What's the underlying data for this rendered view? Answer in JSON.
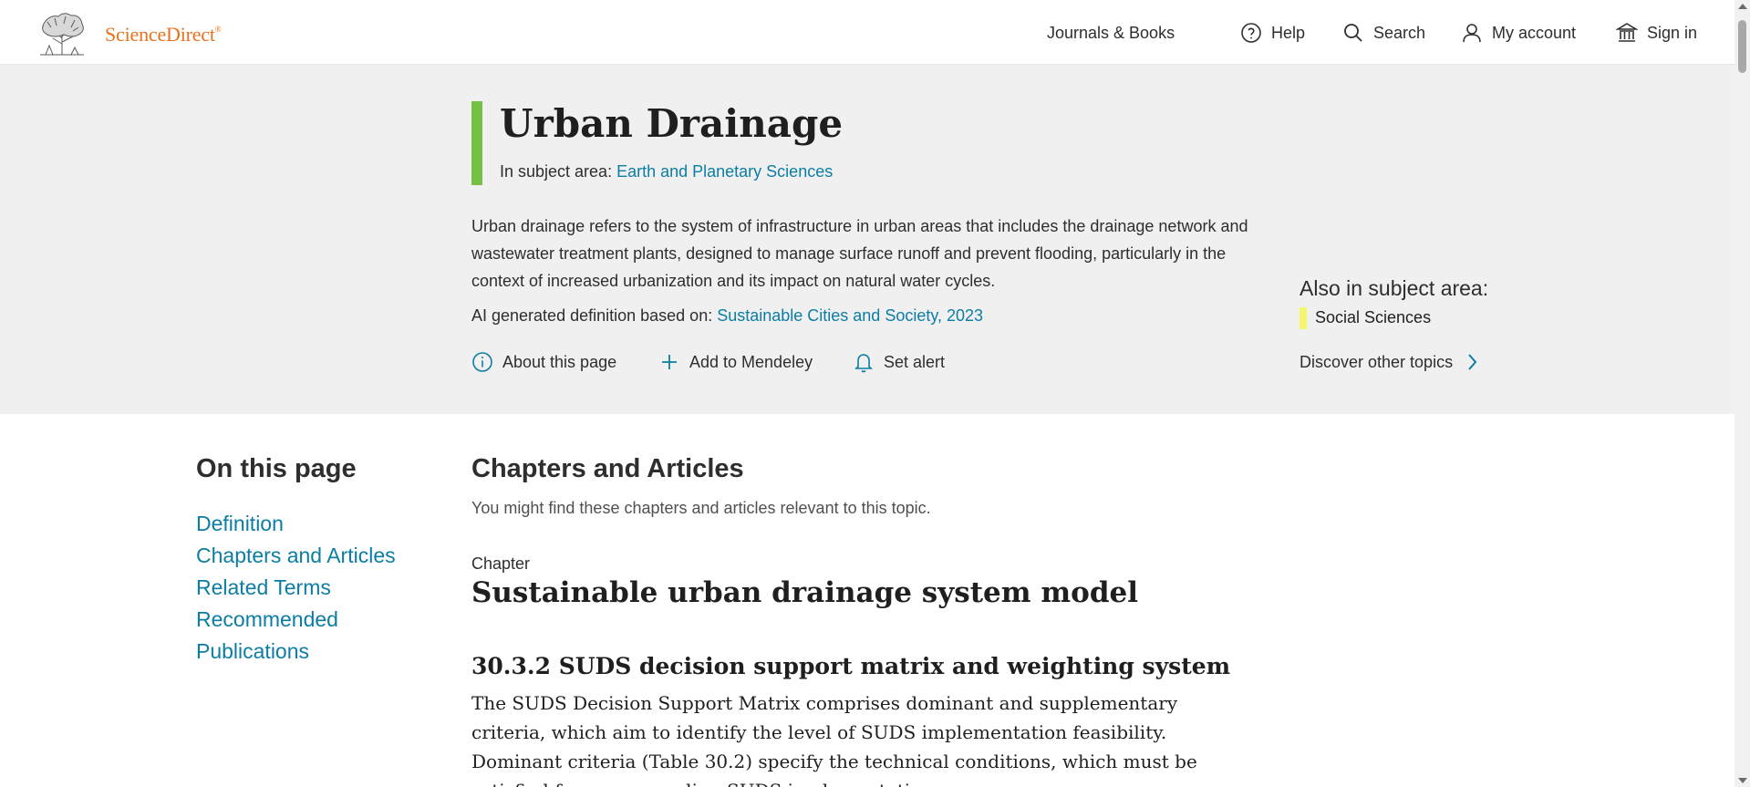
{
  "header": {
    "brand": "ScienceDirect",
    "brand_mark": "®",
    "nav": [
      {
        "label": "Journals & Books",
        "icon": "none"
      },
      {
        "label": "Help",
        "icon": "help-circle-icon"
      },
      {
        "label": "Search",
        "icon": "search-icon"
      },
      {
        "label": "My account",
        "icon": "user-icon"
      },
      {
        "label": "Sign in",
        "icon": "institution-icon"
      }
    ]
  },
  "hero": {
    "title": "Urban Drainage",
    "subject_prefix": "In subject area: ",
    "subject_link": "Earth and Planetary Sciences",
    "definition": "Urban drainage refers to the system of infrastructure in urban areas that includes the drainage network and wastewater treatment plants, designed to manage surface runoff and prevent flooding, particularly in the context of increased urbanization and its impact on natural water cycles.",
    "ai_prefix": "AI generated definition based on: ",
    "ai_link": "Sustainable Cities and Society, 2023",
    "actions": [
      {
        "label": "About this page",
        "icon": "info-icon"
      },
      {
        "label": "Add to Mendeley",
        "icon": "plus-icon"
      },
      {
        "label": "Set alert",
        "icon": "bell-icon"
      }
    ],
    "also_title": "Also in subject area:",
    "also_items": [
      "Social Sciences"
    ],
    "discover_label": "Discover other topics"
  },
  "sidebar": {
    "title": "On this page",
    "items": [
      "Definition",
      "Chapters and Articles",
      "Related Terms",
      "Recommended",
      "Publications"
    ]
  },
  "main": {
    "section_title": "Chapters and Articles",
    "section_subtitle": "You might find these chapters and articles relevant to this topic.",
    "chapter_label": "Chapter",
    "chapter_title": "Sustainable urban drainage system model",
    "subsection_title": "30.3.2 SUDS decision support matrix and weighting system",
    "body": "The SUDS Decision Support Matrix comprises dominant and supplementary criteria, which aim to identify the level of SUDS implementation feasibility. Dominant criteria (Table 30.2) specify the technical conditions, which must be satisfied for corresponding SUDS implementation."
  },
  "colors": {
    "brand": "#e9711c",
    "link": "#0c7da4",
    "title_accent": "#76c043",
    "also_accent": "#f5f56e",
    "hero_bg": "#f0f0f0"
  }
}
